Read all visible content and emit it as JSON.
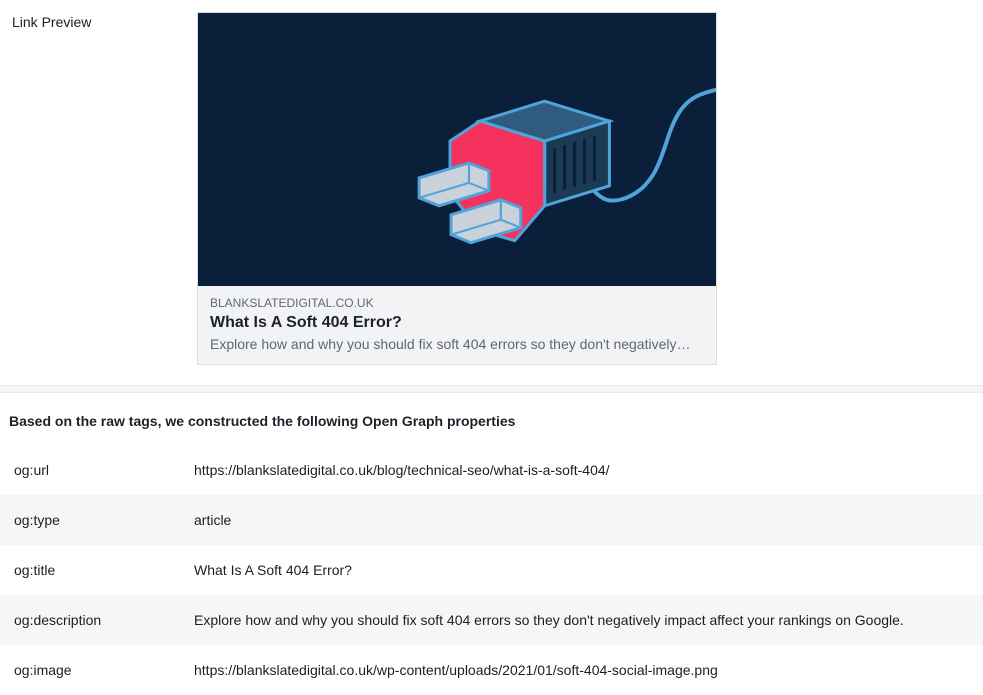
{
  "preview": {
    "label": "Link Preview",
    "domain": "BLANKSLATEDIGITAL.CO.UK",
    "title": "What Is A Soft 404 Error?",
    "description": "Explore how and why you should fix soft 404 errors so they don't negatively…",
    "image_alt": "unplugged-cable-icon",
    "colors": {
      "background": "#0a1f3a",
      "plug_body": "#2e5b7e",
      "plug_face": "#f5315e",
      "prong": "#c9d2da",
      "outline": "#4fa4d9"
    }
  },
  "og_section": {
    "heading": "Based on the raw tags, we constructed the following Open Graph properties",
    "properties": [
      {
        "key": "og:url",
        "value": "https://blankslatedigital.co.uk/blog/technical-seo/what-is-a-soft-404/"
      },
      {
        "key": "og:type",
        "value": "article"
      },
      {
        "key": "og:title",
        "value": "What Is A Soft 404 Error?"
      },
      {
        "key": "og:description",
        "value": "Explore how and why you should fix soft 404 errors so they don't negatively impact affect your rankings on Google."
      },
      {
        "key": "og:image",
        "value": "https://blankslatedigital.co.uk/wp-content/uploads/2021/01/soft-404-social-image.png"
      }
    ]
  }
}
